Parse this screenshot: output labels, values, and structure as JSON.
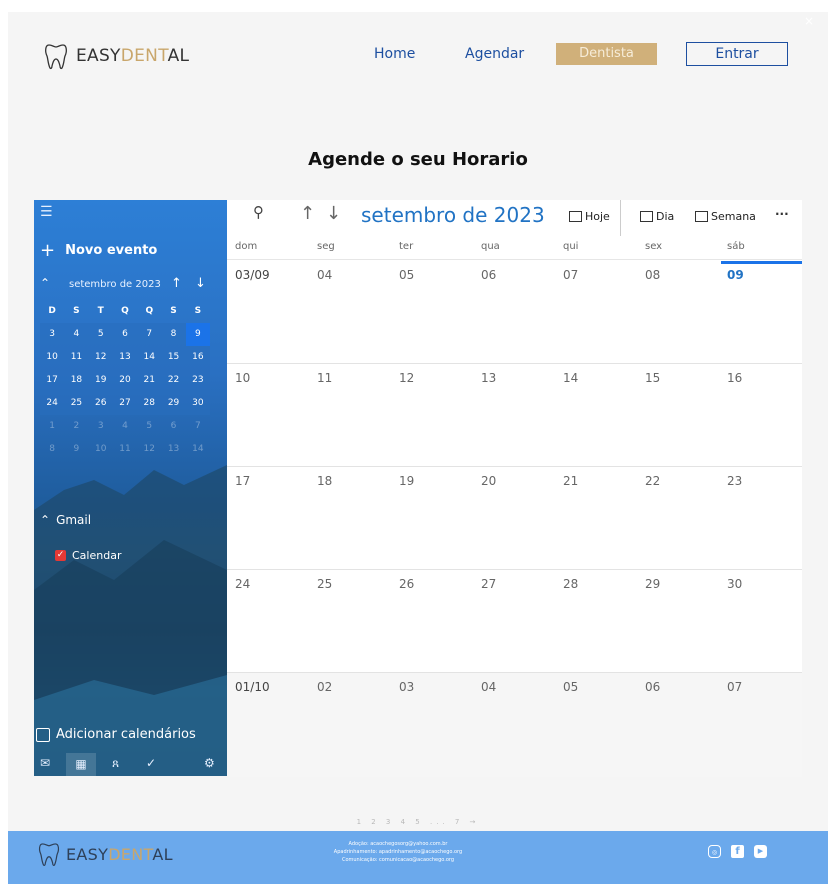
{
  "header": {
    "logo_prefix": "EASY",
    "logo_gold": "DENT",
    "logo_suffix": "AL",
    "nav": {
      "home": "Home",
      "agendar": "Agendar",
      "dentista": "Dentista",
      "entrar": "Entrar"
    }
  },
  "heading": "Agende o seu Horario",
  "calendar": {
    "sidebar": {
      "new_event": "Novo evento",
      "mini_month": "setembro de 2023",
      "weekday_initials": [
        "D",
        "S",
        "T",
        "Q",
        "Q",
        "S",
        "S"
      ],
      "mini_weeks": [
        [
          "3",
          "4",
          "5",
          "6",
          "7",
          "8",
          "9"
        ],
        [
          "10",
          "11",
          "12",
          "13",
          "14",
          "15",
          "16"
        ],
        [
          "17",
          "18",
          "19",
          "20",
          "21",
          "22",
          "23"
        ],
        [
          "24",
          "25",
          "26",
          "27",
          "28",
          "29",
          "30"
        ],
        [
          "1",
          "2",
          "3",
          "4",
          "5",
          "6",
          "7"
        ],
        [
          "8",
          "9",
          "10",
          "11",
          "12",
          "13",
          "14"
        ]
      ],
      "today": "9",
      "group": "Gmail",
      "calendar_name": "Calendar",
      "add_calendars": "Adicionar calendários"
    },
    "toolbar": {
      "month": "setembro de 2023",
      "today": "Hoje",
      "day": "Dia",
      "week": "Semana",
      "more": "···"
    },
    "weekdays": [
      "dom",
      "seg",
      "ter",
      "qua",
      "qui",
      "sex",
      "sáb"
    ],
    "weeks": [
      [
        "03/09",
        "04",
        "05",
        "06",
        "07",
        "08",
        "09"
      ],
      [
        "10",
        "11",
        "12",
        "13",
        "14",
        "15",
        "16"
      ],
      [
        "17",
        "18",
        "19",
        "20",
        "21",
        "22",
        "23"
      ],
      [
        "24",
        "25",
        "26",
        "27",
        "28",
        "29",
        "30"
      ],
      [
        "01/10",
        "02",
        "03",
        "04",
        "05",
        "06",
        "07"
      ]
    ],
    "today_label": "09"
  },
  "pagination": "1 2 3 4 5 ... 7 →",
  "footer": {
    "info": [
      "Adoção: acaochegosorg@yahoo.com.br",
      "Apadrinhamento: apadrinhamento@acaochego.org",
      "Comunicação: comunicacao@acaochego.org"
    ]
  },
  "colors": {
    "accent": "#2173c4",
    "sidebar": "#2a70c2",
    "gold": "#d0b07a",
    "footer": "#6ba9ec"
  }
}
